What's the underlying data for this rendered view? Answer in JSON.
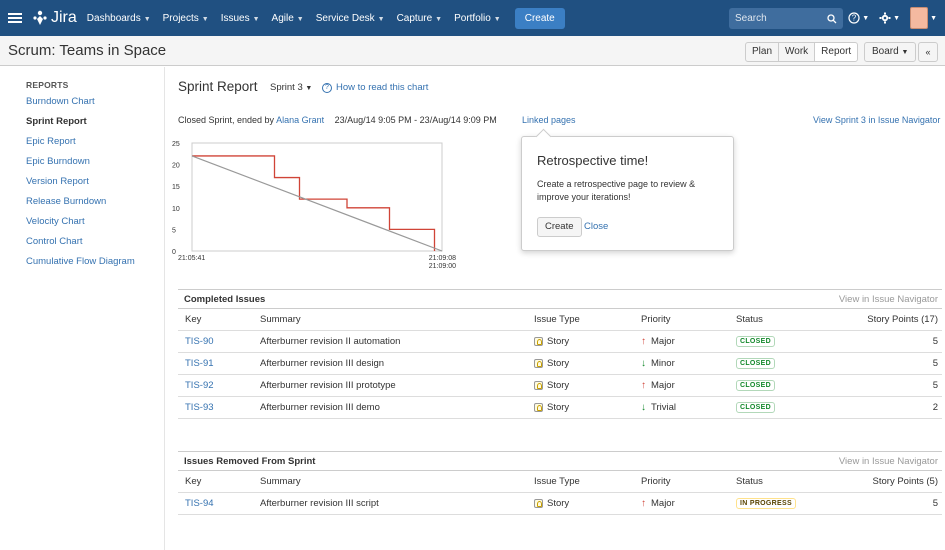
{
  "nav": {
    "logo": "Jira",
    "items": [
      "Dashboards",
      "Projects",
      "Issues",
      "Agile",
      "Service Desk",
      "Capture",
      "Portfolio"
    ],
    "create": "Create",
    "search_placeholder": "Search"
  },
  "header": {
    "title": "Scrum: Teams in Space",
    "views": [
      "Plan",
      "Work",
      "Report"
    ],
    "active_view": "Report",
    "board": "Board",
    "collapse": "«"
  },
  "sidebar": {
    "title": "REPORTS",
    "items": [
      "Burndown Chart",
      "Sprint Report",
      "Epic Report",
      "Epic Burndown",
      "Version Report",
      "Release Burndown",
      "Velocity Chart",
      "Control Chart",
      "Cumulative Flow Diagram"
    ],
    "active": "Sprint Report"
  },
  "report": {
    "title": "Sprint Report",
    "sprint": "Sprint 3",
    "howto": "How to read this chart",
    "info_prefix": "Closed Sprint, ended by",
    "user": "Alana Grant",
    "dates": "23/Aug/14 9:05 PM - 23/Aug/14 9:09 PM",
    "linked": "Linked pages",
    "view_sprint": "View Sprint 3 in Issue Navigator"
  },
  "chart_data": {
    "type": "line",
    "x_ticks": [
      "21:05:41",
      "21:09:08",
      "21:09:00"
    ],
    "y_ticks": [
      0,
      5,
      10,
      15,
      20,
      25
    ],
    "ylim": [
      0,
      25
    ],
    "series": [
      {
        "color": "#d04437",
        "points": [
          [
            0,
            22
          ],
          [
            0.33,
            22
          ],
          [
            0.33,
            17
          ],
          [
            0.43,
            17
          ],
          [
            0.43,
            12
          ],
          [
            0.62,
            12
          ],
          [
            0.62,
            10
          ],
          [
            0.79,
            10
          ],
          [
            0.79,
            5
          ],
          [
            0.97,
            5
          ],
          [
            0.97,
            0
          ]
        ]
      },
      {
        "color": "#999999",
        "points": [
          [
            0,
            22
          ],
          [
            1,
            0
          ]
        ]
      }
    ]
  },
  "popup": {
    "title": "Retrospective time!",
    "body": "Create a retrospective page to review & improve your iterations!",
    "create": "Create",
    "close": "Close"
  },
  "completed": {
    "title": "Completed Issues",
    "link": "View in Issue Navigator",
    "columns": [
      "Key",
      "Summary",
      "Issue Type",
      "Priority",
      "Status",
      "Story Points (17)"
    ],
    "rows": [
      {
        "key": "TIS-90",
        "summary": "Afterburner revision II automation",
        "type": "Story",
        "priority": "Major",
        "status": "CLOSED",
        "points": "5"
      },
      {
        "key": "TIS-91",
        "summary": "Afterburner revision III design",
        "type": "Story",
        "priority": "Minor",
        "status": "CLOSED",
        "points": "5"
      },
      {
        "key": "TIS-92",
        "summary": "Afterburner revision III prototype",
        "type": "Story",
        "priority": "Major",
        "status": "CLOSED",
        "points": "5"
      },
      {
        "key": "TIS-93",
        "summary": "Afterburner revision III demo",
        "type": "Story",
        "priority": "Trivial",
        "status": "CLOSED",
        "points": "2"
      }
    ]
  },
  "removed": {
    "title": "Issues Removed From Sprint",
    "link": "View in Issue Navigator",
    "columns": [
      "Key",
      "Summary",
      "Issue Type",
      "Priority",
      "Status",
      "Story Points (5)"
    ],
    "rows": [
      {
        "key": "TIS-94",
        "summary": "Afterburner revision III script",
        "type": "Story",
        "priority": "Major",
        "status": "IN PROGRESS",
        "points": "5"
      }
    ]
  },
  "colors": {
    "nav_bg": "#205081",
    "link": "#3572b0",
    "burndown": "#d04437",
    "guideline": "#999999"
  }
}
